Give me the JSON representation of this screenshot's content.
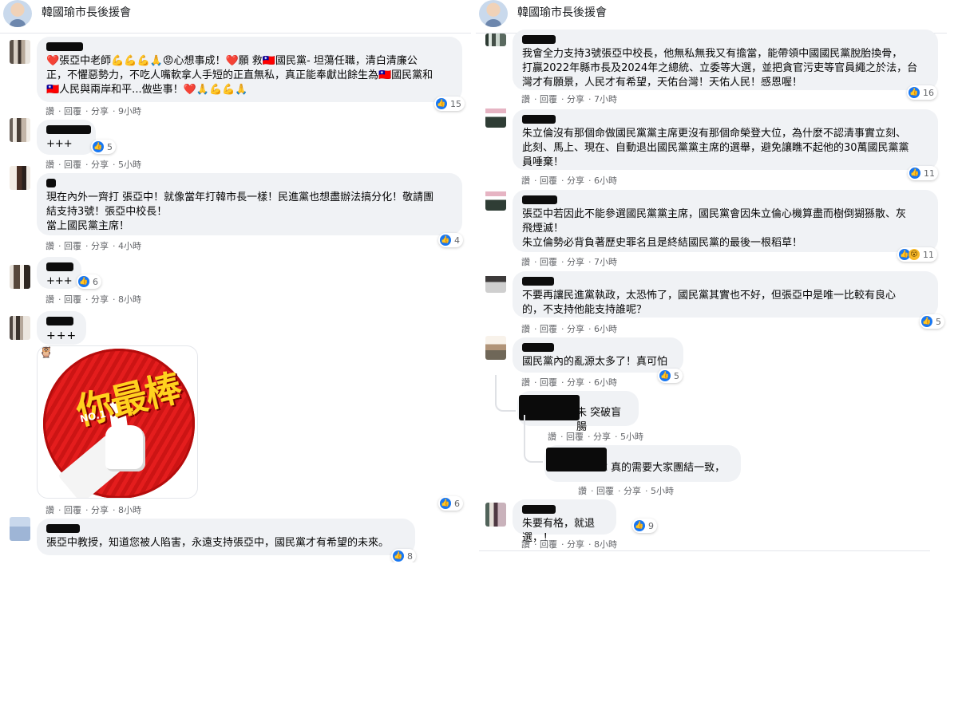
{
  "group": {
    "name": "韓國瑜市長後援會"
  },
  "left_comments": [
    {
      "text": "❤️張亞中老師💪💪💪🙏😡心想事成！❤️願 救🇹🇼國民黨- 坦蕩任職，清白清廉公\n正，不懼惡勢力，不吃人嘴軟拿人手短的正直無私，真正能奉獻出餘生為🇹🇼國民黨和\n🇹🇼人民與兩岸和平...做些事！❤️🙏💪💪🙏",
      "reactions": "15",
      "actions": [
        "讚",
        "回覆",
        "分享",
        "9小時"
      ]
    },
    {
      "text": "+++",
      "reactions": "5",
      "actions": [
        "讚",
        "回覆",
        "分享",
        "5小時"
      ]
    },
    {
      "text": "現在內外一齊打 張亞中！就像當年打韓市長一樣！民進黨也想盡辦法搞分化！敬請團\n結支持3號！張亞中校長！\n當上國民黨主席！",
      "reactions": "4",
      "actions": [
        "讚",
        "回覆",
        "分享",
        "4小時"
      ]
    },
    {
      "text": "+++",
      "reactions": "6",
      "actions": [
        "讚",
        "回覆",
        "分享",
        "8小時"
      ]
    },
    {
      "text": "+++",
      "reactions": "6",
      "actions": [
        "讚",
        "回覆",
        "分享",
        "8小時"
      ],
      "sticker": {
        "word": "你最棒",
        "badge": "NO.1"
      }
    },
    {
      "text": "張亞中教授，知道您被人陷害，永遠支持張亞中，國民黨才有希望的未來。",
      "reactions": "8",
      "actions": [
        "讚",
        "回覆",
        "分享",
        "8小時"
      ]
    }
  ],
  "right_comments": [
    {
      "text": "我會全力支持3號張亞中校長，他無私無我又有擔當，能帶領中國國民黨脫胎換骨，\n打贏2022年縣市長及2024年之總統、立委等大選，並把貪官污吏等官員繩之於法，台\n灣才有願景，人民才有希望，天佑台灣！天佑人民！感恩喔！",
      "reactions": "16",
      "actions": [
        "讚",
        "回覆",
        "分享",
        "7小時"
      ]
    },
    {
      "text": "朱立倫沒有那個命做國民黨黨主席更沒有那個命榮登大位，為什麼不認清事實立刻、\n此刻、馬上、現在、自動退出國民黨黨主席的選舉，避免讓瞧不起他的30萬國民黨黨\n員唾棄！",
      "reactions": "11",
      "actions": [
        "讚",
        "回覆",
        "分享",
        "6小時"
      ]
    },
    {
      "text": "張亞中若因此不能參選國民黨黨主席，國民黨會因朱立倫心機算盡而樹倒猢猻散、灰\n飛煙滅！\n朱立倫勢必背負著歷史罪名且是終結國民黨的最後一根稻草！",
      "reactions": "11",
      "actions": [
        "讚",
        "回覆",
        "分享",
        "7小時"
      ]
    },
    {
      "text": "不要再讓民進黨執政，太恐怖了，國民黨其實也不好，但張亞中是唯一比較有良心\n的，不支持他能支持誰呢？",
      "reactions": "5",
      "actions": [
        "讚",
        "回覆",
        "分享",
        "6小時"
      ]
    },
    {
      "text": "國民黨內的亂源太多了！真可怕",
      "reactions": "5",
      "actions": [
        "讚",
        "回覆",
        "分享",
        "6小時"
      ]
    },
    {
      "text": "朱 突破盲腸",
      "reactions": "",
      "actions": [
        "讚",
        "回覆",
        "分享",
        "5小時"
      ]
    },
    {
      "text": "瑋 真的需要大家團結一致，",
      "reactions": "",
      "actions": [
        "讚",
        "回覆",
        "分享",
        "5小時"
      ]
    },
    {
      "text": "朱要有格，就退選，！",
      "reactions": "9",
      "actions": [
        "讚",
        "回覆",
        "分享",
        "8小時"
      ]
    }
  ]
}
